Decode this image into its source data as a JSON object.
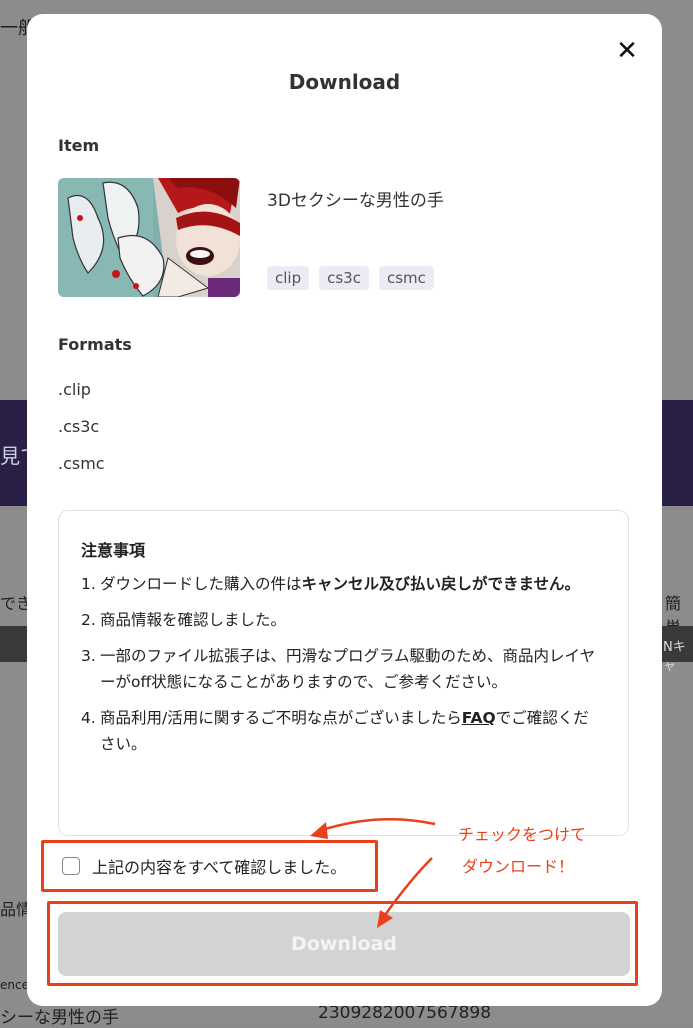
{
  "background": {
    "top_left_text": "一般",
    "band_left_text": "見て",
    "mid_left_text": "でき",
    "mid_right_text": "簡単",
    "bar_right_text": "Nキャ",
    "lower_left_text": "品情",
    "ref_text": "ence",
    "bottom_name": "シーな男性の手",
    "bottom_number": "2309282007567898"
  },
  "modal": {
    "title": "Download",
    "close_label": "✕",
    "item_label": "Item",
    "item_name": "3Dセクシーな男性の手",
    "tags": [
      "clip",
      "cs3c",
      "csmc"
    ],
    "formats_label": "Formats",
    "formats": [
      ".clip",
      ".cs3c",
      ".csmc"
    ],
    "notice": {
      "title": "注意事項",
      "items": [
        {
          "num": "1.",
          "pre": "ダウンロードした購入の件は",
          "bold": "キャンセル及び払い戻しができません。"
        },
        {
          "num": "2.",
          "text": "商品情報を確認しました。"
        },
        {
          "num": "3.",
          "text": "一部のファイル拡張子は、円滑なプログラム駆動のため、商品内レイヤーがoff状態になることがありますので、ご参考ください。"
        },
        {
          "num": "4.",
          "pre": "商品利用/活用に関するご不明な点がございましたら",
          "link": "FAQ",
          "post": "でご確認ください。"
        }
      ]
    },
    "confirm_label": "上記の内容をすべて確認しました。",
    "download_button": "Download"
  },
  "annotation": {
    "line1": "チェックをつけて",
    "line2": "ダウンロード！",
    "color": "#e8401c"
  }
}
